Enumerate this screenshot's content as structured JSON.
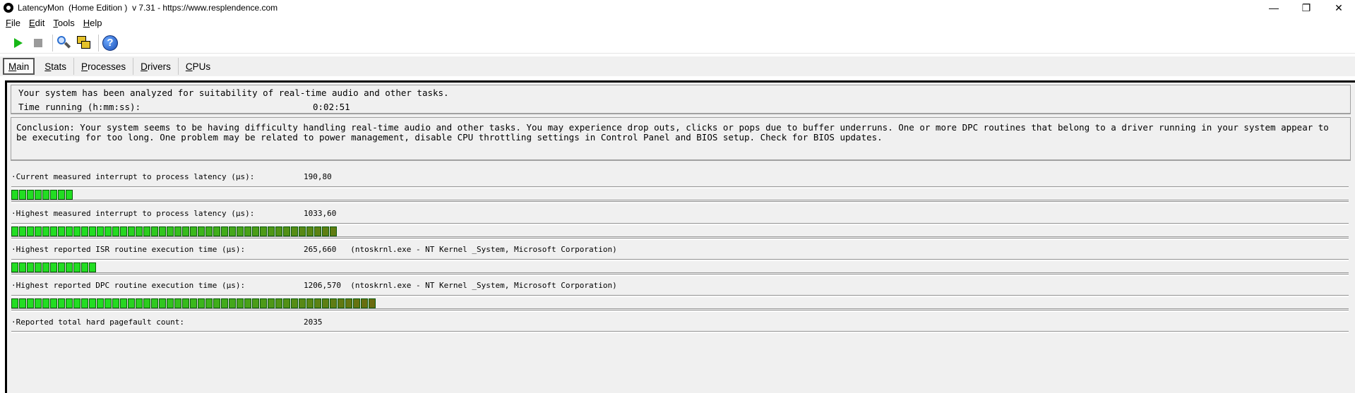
{
  "window": {
    "title": "LatencyMon  (Home Edition )  v 7.31 - https://www.resplendence.com",
    "controls": {
      "minimize": "—",
      "maximize": "❐",
      "close": "✕"
    }
  },
  "menu": [
    {
      "label": "File",
      "access": "F",
      "rest": "ile"
    },
    {
      "label": "Edit",
      "access": "E",
      "rest": "dit"
    },
    {
      "label": "Tools",
      "access": "T",
      "rest": "ools"
    },
    {
      "label": "Help",
      "access": "H",
      "rest": "elp"
    }
  ],
  "toolbar": {
    "icons": [
      "play-icon",
      "stop-icon",
      "analyze-icon",
      "windows-icon",
      "help-icon"
    ],
    "help_glyph": "?"
  },
  "tabs": [
    {
      "label": "Main",
      "access": "M",
      "rest": "ain",
      "active": true
    },
    {
      "label": "Stats",
      "access": "S",
      "rest": "tats",
      "active": false
    },
    {
      "label": "Processes",
      "access": "P",
      "rest": "rocesses",
      "active": false
    },
    {
      "label": "Drivers",
      "access": "D",
      "rest": "rivers",
      "active": false
    },
    {
      "label": "CPUs",
      "access": "C",
      "rest": "PUs",
      "active": false
    }
  ],
  "summary": {
    "status": "Your system has been analyzed for suitability of real-time audio and other tasks.",
    "time_label": "Time running (h:mm:ss):",
    "time_value": "0:02:51"
  },
  "conclusion": "Conclusion: Your system seems to be having difficulty handling real-time audio and other tasks. You may experience drop outs, clicks or pops due to buffer underruns. One or more DPC routines that belong to a driver running in your system appear to be executing for too long. One problem may be related to power management, disable CPU throttling settings in Control Panel and BIOS setup. Check for BIOS updates.",
  "metrics": [
    {
      "label": "·Current measured interrupt to process latency (µs):",
      "value": "190,80",
      "segments": 8
    },
    {
      "label": "·Highest measured interrupt to process latency (µs):",
      "value": "1033,60",
      "segments": 42
    },
    {
      "label": "·Highest reported ISR routine execution time (µs):",
      "value": "265,660   (ntoskrnl.exe - NT Kernel _System, Microsoft Corporation)",
      "segments": 11
    },
    {
      "label": "·Highest reported DPC routine execution time (µs):",
      "value": "1206,570  (ntoskrnl.exe - NT Kernel _System, Microsoft Corporation)",
      "segments": 47
    },
    {
      "label": "·Reported total hard pagefault count:",
      "value": "2035",
      "segments": 0
    }
  ],
  "colors": {
    "bar_green": "#22dd22",
    "bar_olive": "#6b6b10",
    "accent": "#17b817"
  }
}
